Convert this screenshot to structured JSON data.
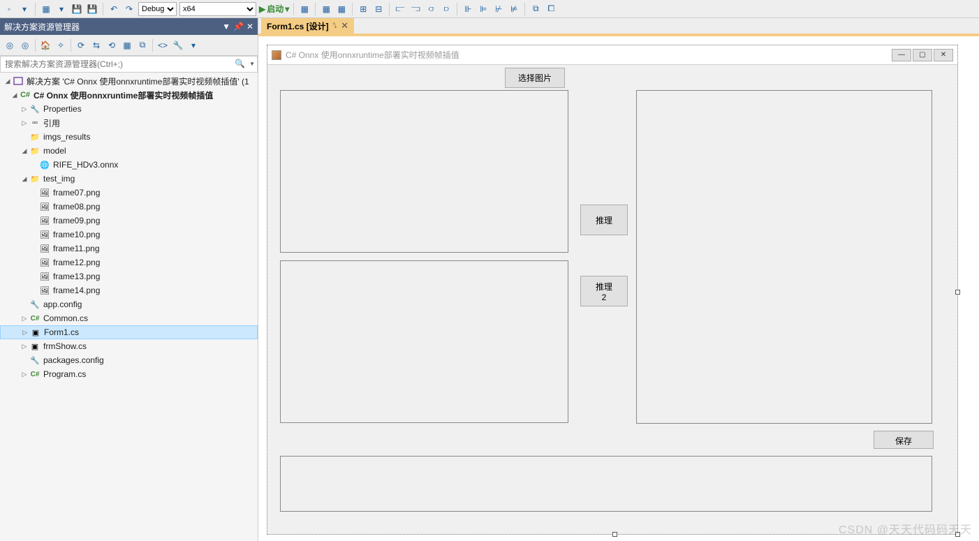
{
  "topbar": {
    "config": "Debug",
    "platform": "x64",
    "start_label": "启动"
  },
  "solution_explorer": {
    "title": "解决方案资源管理器",
    "search_placeholder": "搜索解决方案资源管理器(Ctrl+;)",
    "solution_label": "解决方案 'C# Onnx 使用onnxruntime部署实时视频帧插值' (1",
    "project_label": "C# Onnx 使用onnxruntime部署实时视频帧插值",
    "nodes": {
      "properties": "Properties",
      "references": "引用",
      "imgs_results": "imgs_results",
      "model": "model",
      "model_children": [
        "RIFE_HDv3.onnx"
      ],
      "test_img": "test_img",
      "test_img_children": [
        "frame07.png",
        "frame08.png",
        "frame09.png",
        "frame10.png",
        "frame11.png",
        "frame12.png",
        "frame13.png",
        "frame14.png"
      ],
      "app_config": "app.config",
      "common_cs": "Common.cs",
      "form1_cs": "Form1.cs",
      "frmshow_cs": "frmShow.cs",
      "packages_config": "packages.config",
      "program_cs": "Program.cs"
    }
  },
  "tab": {
    "name": "Form1.cs [设计]"
  },
  "form": {
    "title": "C# Onnx 使用onnxruntime部署实时视频帧插值",
    "btn_select": "选择图片",
    "btn_infer": "推理",
    "btn_infer2": "推理2",
    "btn_save": "保存"
  },
  "watermark": "CSDN @天天代码码天天"
}
